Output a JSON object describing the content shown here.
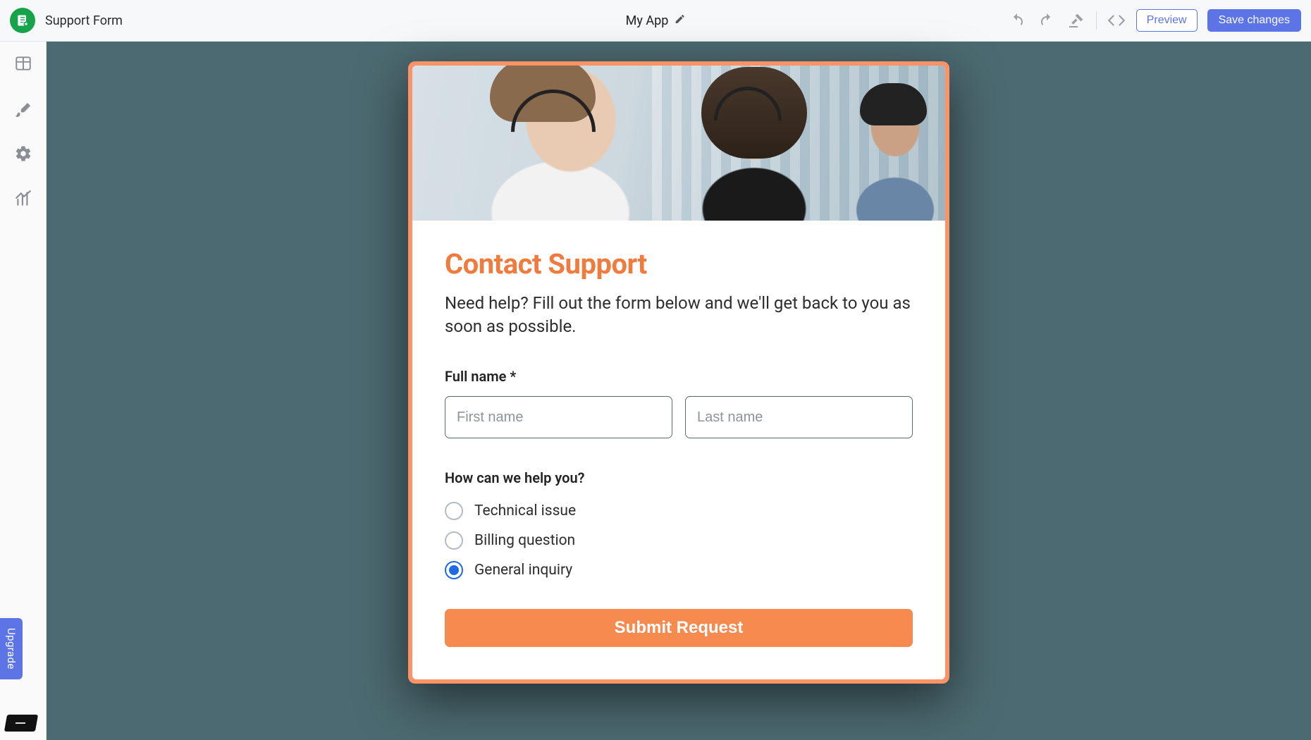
{
  "header": {
    "page_label": "Support Form",
    "app_name": "My App",
    "preview_label": "Preview",
    "save_label": "Save changes"
  },
  "rail": {
    "upgrade_label": "Upgrade"
  },
  "form": {
    "title": "Contact Support",
    "subtitle": "Need help? Fill out the form below and we'll get back to you as soon as possible.",
    "fullname_label": "Full name *",
    "first_name_placeholder": "First name",
    "last_name_placeholder": "Last name",
    "help_label": "How can we help you?",
    "options": [
      {
        "label": "Technical issue",
        "selected": false
      },
      {
        "label": "Billing question",
        "selected": false
      },
      {
        "label": "General inquiry",
        "selected": true
      }
    ],
    "submit_label": "Submit Request"
  },
  "colors": {
    "accent_orange": "#f78a4f",
    "accent_blue": "#5c74e6",
    "stage_bg": "#4c6a71"
  }
}
